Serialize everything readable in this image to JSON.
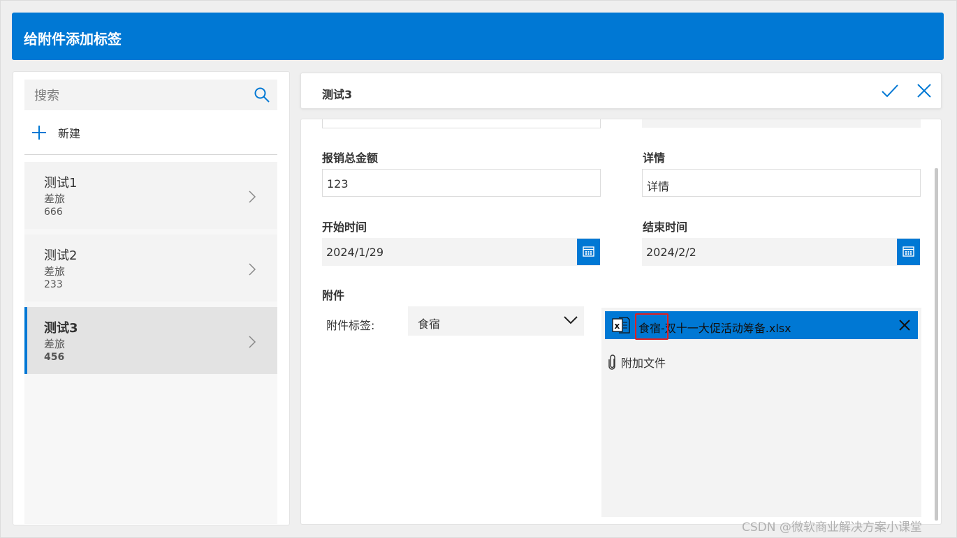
{
  "app": {
    "title": "给附件添加标签"
  },
  "sidebar": {
    "search_placeholder": "搜索",
    "new_label": "新建",
    "items": [
      {
        "title": "测试1",
        "type": "差旅",
        "amount": "666",
        "selected": false
      },
      {
        "title": "测试2",
        "type": "差旅",
        "amount": "233",
        "selected": false
      },
      {
        "title": "测试3",
        "type": "差旅",
        "amount": "456",
        "selected": true
      }
    ]
  },
  "detail": {
    "title": "测试3",
    "fields": {
      "total_label": "报销总金额",
      "total_value": "123",
      "details_label": "详情",
      "details_value": "详情",
      "start_label": "开始时间",
      "start_value": "2024/1/29",
      "end_label": "结束时间",
      "end_value": "2024/2/2",
      "attachment_label": "附件",
      "attachment_tag_label": "附件标签:",
      "attachment_tag_value": "食宿"
    },
    "attachments": {
      "file_name": "食宿-双十一大促活动筹备.xlsx",
      "attach_label": "附加文件"
    }
  },
  "colors": {
    "accent": "#0078d4",
    "highlight": "#e02020"
  },
  "watermark": "CSDN @微软商业解决方案小课堂"
}
